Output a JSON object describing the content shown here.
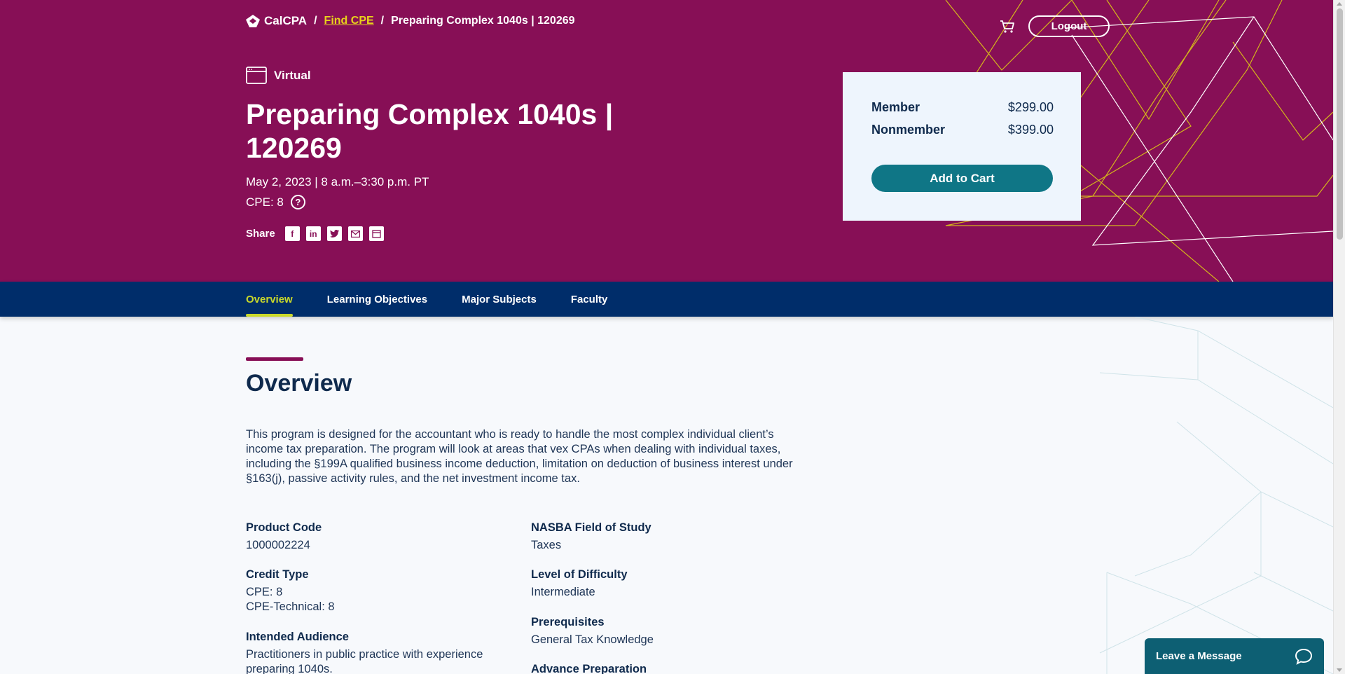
{
  "breadcrumb": {
    "logo": "CalCPA",
    "separator": "/",
    "link": "Find CPE",
    "current": "Preparing Complex 1040s | 120269"
  },
  "header": {
    "cart_icon": "cart-icon",
    "logout_label": "Logout"
  },
  "course": {
    "format": "Virtual",
    "title": "Preparing Complex 1040s | 120269",
    "date": "May 2, 2023 | 8 a.m.–3:30 p.m. PT",
    "cpe": "CPE: 8",
    "cpe_help_glyph": "?",
    "share_label": "Share",
    "share_icons": [
      "facebook-icon",
      "linkedin-icon",
      "twitter-icon",
      "email-icon",
      "calendar-icon"
    ]
  },
  "pricing": {
    "member_label": "Member",
    "member_price": "$299.00",
    "nonmember_label": "Nonmember",
    "nonmember_price": "$399.00",
    "add_to_cart": "Add to Cart"
  },
  "tabs": [
    {
      "label": "Overview",
      "active": true
    },
    {
      "label": "Learning Objectives",
      "active": false
    },
    {
      "label": "Major Subjects",
      "active": false
    },
    {
      "label": "Faculty",
      "active": false
    }
  ],
  "overview": {
    "heading": "Overview",
    "description": "This program is designed for the accountant who is ready to handle the most complex individual client’s income tax preparation. The program will look at areas that vex CPAs when dealing with individual taxes, including the §199A qualified business income deduction, limitation on deduction of business interest under §163(j), passive activity rules, and the net investment income tax.",
    "left_fields": [
      {
        "label": "Product Code",
        "values": [
          "1000002224"
        ]
      },
      {
        "label": "Credit Type",
        "values": [
          "CPE: 8",
          "CPE-Technical: 8"
        ]
      },
      {
        "label": "Intended Audience",
        "values": [
          "Practitioners in public practice with experience preparing 1040s."
        ]
      }
    ],
    "right_fields": [
      {
        "label": "NASBA Field of Study",
        "values": [
          "Taxes"
        ]
      },
      {
        "label": "Level of Difficulty",
        "values": [
          "Intermediate"
        ]
      },
      {
        "label": "Prerequisites",
        "values": [
          "General Tax Knowledge"
        ]
      },
      {
        "label": "Advance Preparation",
        "values": []
      }
    ]
  },
  "chat": {
    "label": "Leave a Message",
    "icon": "chat-bubble-icon"
  },
  "colors": {
    "hero": "#870f56",
    "nav": "#002d6a",
    "accent_yellow": "#c9d92a",
    "button_teal": "#0f7686",
    "card_bg": "#eef5fd",
    "chat_bg": "#0d5f73"
  }
}
